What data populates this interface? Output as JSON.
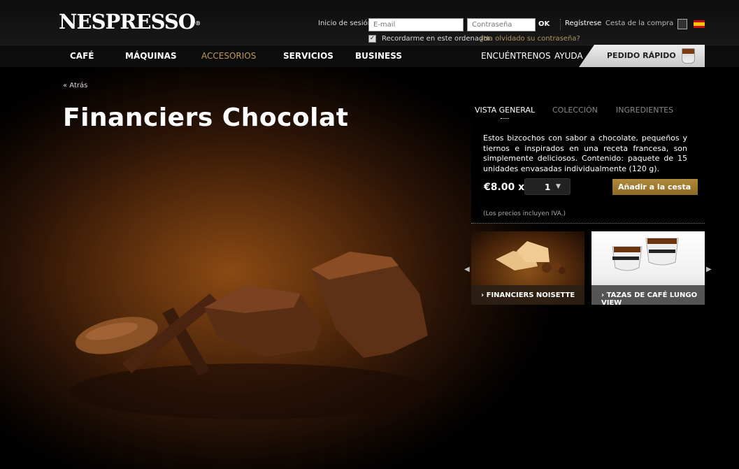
{
  "brand": {
    "logo": "NESPRESSO"
  },
  "login": {
    "label": "Inicio de sesión",
    "email_placeholder": "E-mail",
    "password_placeholder": "Contraseña",
    "ok": "OK",
    "register": "Regístrese",
    "cart": "Cesta de la compra",
    "remember": "Recordarme en este ordenador",
    "forgot": "¿Ha olvidado su contraseña?"
  },
  "nav": {
    "items": [
      "CAFÉ",
      "MÁQUINAS",
      "ACCESORIOS",
      "SERVICIOS",
      "BUSINESS"
    ],
    "right": [
      "ENCUÉNTRENOS",
      "AYUDA"
    ],
    "quick_order": "PEDIDO RÁPIDO"
  },
  "breadcrumb": "Atrás",
  "product": {
    "title": "Financiers Chocolat",
    "tabs": [
      "VISTA GENERAL",
      "COLECCIÓN",
      "INGREDIENTES"
    ],
    "description": "Estos bizcochos con sabor a chocolate, pequeños y tiernos e inspirados en una receta francesa, son simplemente deliciosos. Contenido: paquete de 15 unidades envasadas individualmente (120 g).",
    "price": "€8.00",
    "times": "x",
    "quantity": "1",
    "add_to_cart": "Añadir a la cesta",
    "vat_note": "(Los precios incluyen IVA.)"
  },
  "related": [
    {
      "label": "FINANCIERS NOISETTE"
    },
    {
      "label": "TAZAS DE CAFÉ LUNGO VIEW"
    }
  ],
  "colors": {
    "accent": "#c09a55",
    "button": "#9c7a30"
  }
}
